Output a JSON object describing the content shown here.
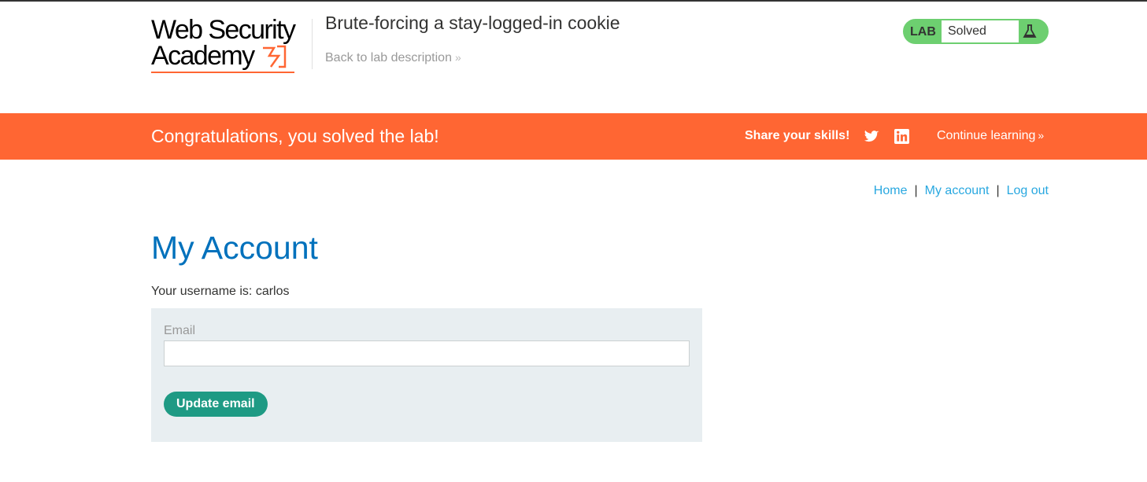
{
  "header": {
    "logo_line1": "Web Security",
    "logo_line2": "Academy",
    "lab_title": "Brute-forcing a stay-logged-in cookie",
    "back_link": "Back to lab description",
    "back_chevron": "»",
    "lab_badge": {
      "label": "LAB",
      "status": "Solved",
      "icon": "flask-icon",
      "color": "#6dcf70"
    }
  },
  "banner": {
    "message": "Congratulations, you solved the lab!",
    "share_label": "Share your skills!",
    "share_icons": [
      "twitter-icon",
      "linkedin-icon"
    ],
    "continue_label": "Continue learning",
    "continue_chevron": "»",
    "color": "#ff6633"
  },
  "nav": {
    "home": "Home",
    "my_account": "My account",
    "log_out": "Log out",
    "separator": "|"
  },
  "main": {
    "title": "My Account",
    "username_line": "Your username is: carlos",
    "form": {
      "email_label": "Email",
      "email_value": "",
      "submit_label": "Update email"
    }
  }
}
